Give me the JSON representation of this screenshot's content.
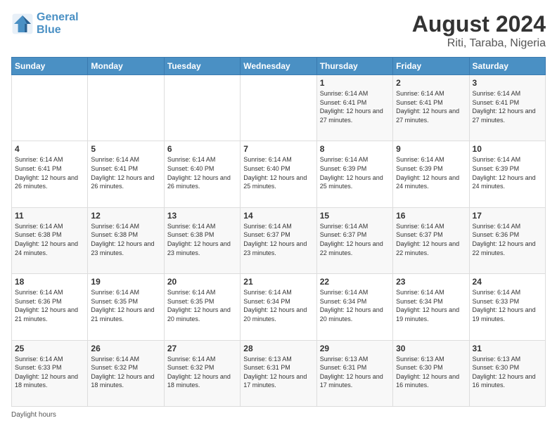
{
  "logo": {
    "line1": "General",
    "line2": "Blue"
  },
  "title": "August 2024",
  "location": "Riti, Taraba, Nigeria",
  "days_of_week": [
    "Sunday",
    "Monday",
    "Tuesday",
    "Wednesday",
    "Thursday",
    "Friday",
    "Saturday"
  ],
  "footer": "Daylight hours",
  "weeks": [
    [
      {
        "day": "",
        "info": ""
      },
      {
        "day": "",
        "info": ""
      },
      {
        "day": "",
        "info": ""
      },
      {
        "day": "",
        "info": ""
      },
      {
        "day": "1",
        "info": "Sunrise: 6:14 AM\nSunset: 6:41 PM\nDaylight: 12 hours and 27 minutes."
      },
      {
        "day": "2",
        "info": "Sunrise: 6:14 AM\nSunset: 6:41 PM\nDaylight: 12 hours and 27 minutes."
      },
      {
        "day": "3",
        "info": "Sunrise: 6:14 AM\nSunset: 6:41 PM\nDaylight: 12 hours and 27 minutes."
      }
    ],
    [
      {
        "day": "4",
        "info": "Sunrise: 6:14 AM\nSunset: 6:41 PM\nDaylight: 12 hours and 26 minutes."
      },
      {
        "day": "5",
        "info": "Sunrise: 6:14 AM\nSunset: 6:41 PM\nDaylight: 12 hours and 26 minutes."
      },
      {
        "day": "6",
        "info": "Sunrise: 6:14 AM\nSunset: 6:40 PM\nDaylight: 12 hours and 26 minutes."
      },
      {
        "day": "7",
        "info": "Sunrise: 6:14 AM\nSunset: 6:40 PM\nDaylight: 12 hours and 25 minutes."
      },
      {
        "day": "8",
        "info": "Sunrise: 6:14 AM\nSunset: 6:39 PM\nDaylight: 12 hours and 25 minutes."
      },
      {
        "day": "9",
        "info": "Sunrise: 6:14 AM\nSunset: 6:39 PM\nDaylight: 12 hours and 24 minutes."
      },
      {
        "day": "10",
        "info": "Sunrise: 6:14 AM\nSunset: 6:39 PM\nDaylight: 12 hours and 24 minutes."
      }
    ],
    [
      {
        "day": "11",
        "info": "Sunrise: 6:14 AM\nSunset: 6:38 PM\nDaylight: 12 hours and 24 minutes."
      },
      {
        "day": "12",
        "info": "Sunrise: 6:14 AM\nSunset: 6:38 PM\nDaylight: 12 hours and 23 minutes."
      },
      {
        "day": "13",
        "info": "Sunrise: 6:14 AM\nSunset: 6:38 PM\nDaylight: 12 hours and 23 minutes."
      },
      {
        "day": "14",
        "info": "Sunrise: 6:14 AM\nSunset: 6:37 PM\nDaylight: 12 hours and 23 minutes."
      },
      {
        "day": "15",
        "info": "Sunrise: 6:14 AM\nSunset: 6:37 PM\nDaylight: 12 hours and 22 minutes."
      },
      {
        "day": "16",
        "info": "Sunrise: 6:14 AM\nSunset: 6:37 PM\nDaylight: 12 hours and 22 minutes."
      },
      {
        "day": "17",
        "info": "Sunrise: 6:14 AM\nSunset: 6:36 PM\nDaylight: 12 hours and 22 minutes."
      }
    ],
    [
      {
        "day": "18",
        "info": "Sunrise: 6:14 AM\nSunset: 6:36 PM\nDaylight: 12 hours and 21 minutes."
      },
      {
        "day": "19",
        "info": "Sunrise: 6:14 AM\nSunset: 6:35 PM\nDaylight: 12 hours and 21 minutes."
      },
      {
        "day": "20",
        "info": "Sunrise: 6:14 AM\nSunset: 6:35 PM\nDaylight: 12 hours and 20 minutes."
      },
      {
        "day": "21",
        "info": "Sunrise: 6:14 AM\nSunset: 6:34 PM\nDaylight: 12 hours and 20 minutes."
      },
      {
        "day": "22",
        "info": "Sunrise: 6:14 AM\nSunset: 6:34 PM\nDaylight: 12 hours and 20 minutes."
      },
      {
        "day": "23",
        "info": "Sunrise: 6:14 AM\nSunset: 6:34 PM\nDaylight: 12 hours and 19 minutes."
      },
      {
        "day": "24",
        "info": "Sunrise: 6:14 AM\nSunset: 6:33 PM\nDaylight: 12 hours and 19 minutes."
      }
    ],
    [
      {
        "day": "25",
        "info": "Sunrise: 6:14 AM\nSunset: 6:33 PM\nDaylight: 12 hours and 18 minutes."
      },
      {
        "day": "26",
        "info": "Sunrise: 6:14 AM\nSunset: 6:32 PM\nDaylight: 12 hours and 18 minutes."
      },
      {
        "day": "27",
        "info": "Sunrise: 6:14 AM\nSunset: 6:32 PM\nDaylight: 12 hours and 18 minutes."
      },
      {
        "day": "28",
        "info": "Sunrise: 6:13 AM\nSunset: 6:31 PM\nDaylight: 12 hours and 17 minutes."
      },
      {
        "day": "29",
        "info": "Sunrise: 6:13 AM\nSunset: 6:31 PM\nDaylight: 12 hours and 17 minutes."
      },
      {
        "day": "30",
        "info": "Sunrise: 6:13 AM\nSunset: 6:30 PM\nDaylight: 12 hours and 16 minutes."
      },
      {
        "day": "31",
        "info": "Sunrise: 6:13 AM\nSunset: 6:30 PM\nDaylight: 12 hours and 16 minutes."
      }
    ]
  ]
}
